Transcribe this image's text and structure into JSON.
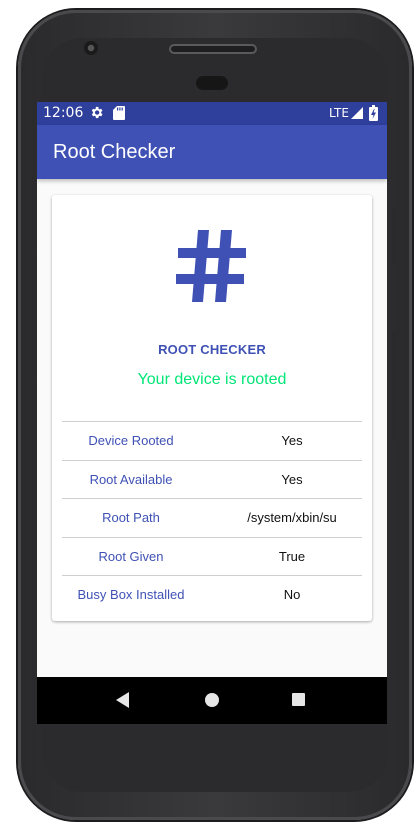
{
  "status_bar": {
    "time": "12:06",
    "network": "LTE",
    "icons": [
      "gear-icon",
      "sd-card-icon",
      "signal-icon",
      "battery-icon"
    ]
  },
  "app_bar": {
    "title": "Root Checker",
    "color": "#3f51b5"
  },
  "card": {
    "icon": "hash-icon",
    "heading": "ROOT CHECKER",
    "status": "Your device is rooted",
    "status_color": "#00e676",
    "rows": [
      {
        "label": "Device Rooted",
        "value": "Yes"
      },
      {
        "label": "Root Available",
        "value": "Yes"
      },
      {
        "label": "Root Path",
        "value": "/system/xbin/su"
      },
      {
        "label": "Root Given",
        "value": "True"
      },
      {
        "label": "Busy Box Installed",
        "value": "No"
      }
    ]
  },
  "nav_bar": {
    "buttons": [
      "back-icon",
      "home-icon",
      "recents-icon"
    ]
  }
}
